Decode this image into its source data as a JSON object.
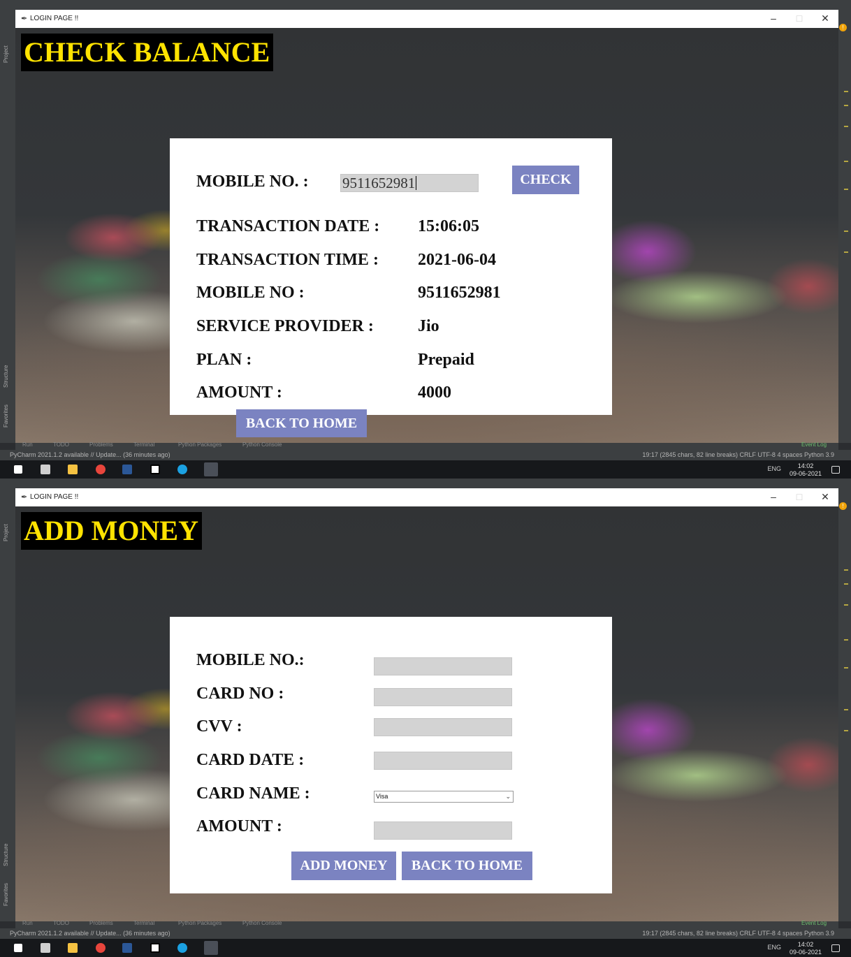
{
  "window_title": "LOGIN PAGE !!",
  "ide": {
    "left_tabs": [
      "Project",
      "Structure",
      "Favorites"
    ],
    "tool_tabs": [
      "Run",
      "TODO",
      "Problems",
      "Terminal",
      "Python Packages",
      "Python Console"
    ],
    "event_log": "Event Log",
    "status_left": "PyCharm 2021.1.2 available // Update... (36 minutes ago)",
    "status_right": "19:17 (2845 chars, 82 line breaks)   CRLF   UTF-8   4 spaces   Python 3.9"
  },
  "taskbar": {
    "language": "ENG",
    "time": "14:02",
    "date": "09-06-2021"
  },
  "check_balance": {
    "heading": "CHECK BALANCE",
    "mobile_label": "MOBILE NO. :",
    "mobile_value": "9511652981",
    "check_button": "CHECK",
    "rows": [
      {
        "label": "TRANSACTION DATE :",
        "value": "15:06:05"
      },
      {
        "label": "TRANSACTION TIME :",
        "value": "2021-06-04"
      },
      {
        "label": "MOBILE NO :",
        "value": "9511652981"
      },
      {
        "label": "SERVICE PROVIDER :",
        "value": "Jio"
      },
      {
        "label": "PLAN :",
        "value": "Prepaid"
      },
      {
        "label": "AMOUNT :",
        "value": "4000"
      }
    ],
    "back_button": "BACK TO HOME"
  },
  "add_money": {
    "heading": "ADD MONEY",
    "fields": [
      {
        "label": "MOBILE NO.:",
        "value": ""
      },
      {
        "label": "CARD NO :",
        "value": ""
      },
      {
        "label": "CVV :",
        "value": ""
      },
      {
        "label": "CARD DATE :",
        "value": ""
      },
      {
        "label": "CARD NAME :",
        "value": "Visa"
      },
      {
        "label": "AMOUNT :",
        "value": ""
      }
    ],
    "add_button": "ADD MONEY",
    "back_button": "BACK TO HOME"
  }
}
